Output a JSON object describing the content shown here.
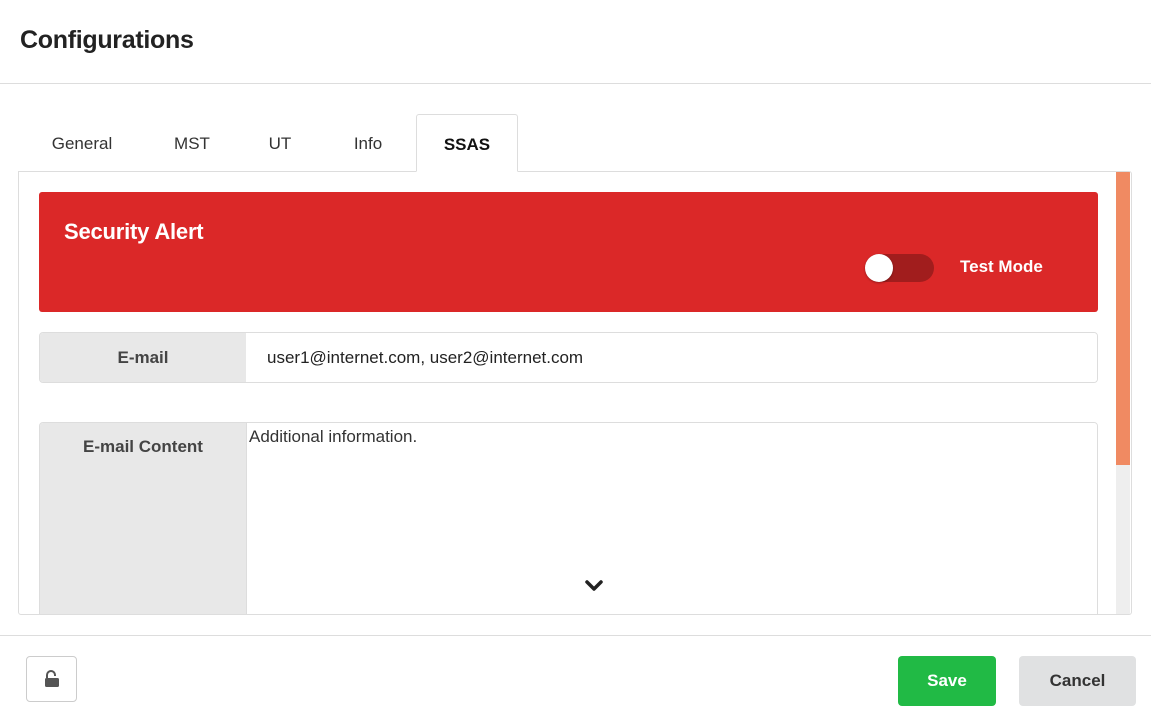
{
  "header": {
    "title": "Configurations"
  },
  "tabs": [
    {
      "label": "General",
      "active": false
    },
    {
      "label": "MST",
      "active": false
    },
    {
      "label": "UT",
      "active": false
    },
    {
      "label": "Info",
      "active": false
    },
    {
      "label": "SSAS",
      "active": true
    }
  ],
  "alert": {
    "title": "Security Alert",
    "toggle_label": "Test Mode",
    "toggle_on": false,
    "color": "#db2828"
  },
  "form": {
    "email": {
      "label": "E-mail",
      "value": "user1@internet.com, user2@internet.com"
    },
    "email_content": {
      "label": "E-mail Content",
      "value": "Additional information."
    }
  },
  "footer": {
    "save_label": "Save",
    "cancel_label": "Cancel",
    "lock_icon": "unlock-icon"
  },
  "colors": {
    "save": "#21ba45",
    "cancel": "#e0e1e2",
    "scrollbar_thumb": "#f08a62"
  }
}
